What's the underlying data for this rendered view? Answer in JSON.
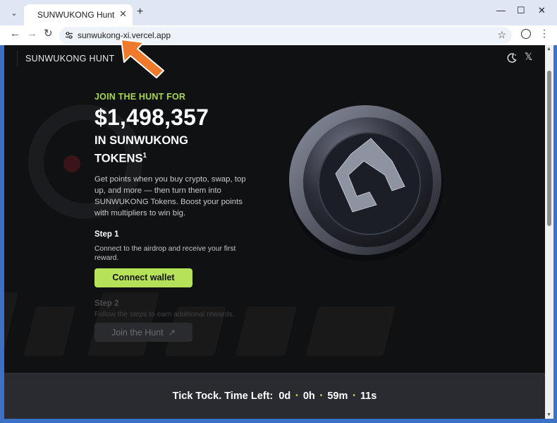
{
  "browser": {
    "tab_title": "SUNWUKONG Hunt",
    "url": "sunwukong-xi.vercel.app",
    "icons": {
      "tab_menu": "chevron-down-icon",
      "close": "close-icon",
      "new_tab": "plus-icon",
      "back": "back-arrow-icon",
      "forward": "forward-arrow-icon",
      "reload": "reload-icon",
      "site_settings": "tune-icon",
      "bookmark": "star-icon",
      "profile": "profile-icon",
      "menu": "kebab-menu-icon",
      "minimize": "minimize-icon",
      "maximize": "maximize-icon",
      "window_close": "window-close-icon"
    },
    "glyphs": {
      "tab_menu": "⌄",
      "tab_close": "✕",
      "new_tab": "+",
      "back": "←",
      "forward": "→",
      "reload": "↻",
      "star": "☆",
      "kebab": "⋮",
      "minimize": "—",
      "maximize": "☐",
      "close": "✕",
      "scroll_up": "▲",
      "scroll_down": "▼"
    }
  },
  "site": {
    "brand": "SUNWUKONG HUNT",
    "x_glyph": "𝕏",
    "hero": {
      "eyebrow": "JOIN THE HUNT FOR",
      "amount": "$1,498,357",
      "tokens_label": "IN SUNWUKONG TOKENS",
      "tokens_footnote": "1",
      "description": "Get points when you buy crypto, swap, top up, and more — then turn them into SUNWUKONG Tokens. Boost your points with multipliers to win big."
    },
    "step1": {
      "title": "Step 1",
      "text": "Connect to the airdrop and receive your first reward.",
      "button": "Connect wallet"
    },
    "step2": {
      "title": "Step 2",
      "text": "Follow the steps to earn additional rewards.",
      "button": "Join the Hunt",
      "button_arrow": "↗"
    },
    "countdown": {
      "label": "Tick Tock. Time Left:",
      "days": "0d",
      "hours": "0h",
      "minutes": "59m",
      "seconds": "11s",
      "separator": "•"
    }
  },
  "colors": {
    "accent": "#b6e25a",
    "page_bg": "#101113",
    "browser_frame": "#3c71c8",
    "annotation_arrow": "#f07a2b"
  }
}
